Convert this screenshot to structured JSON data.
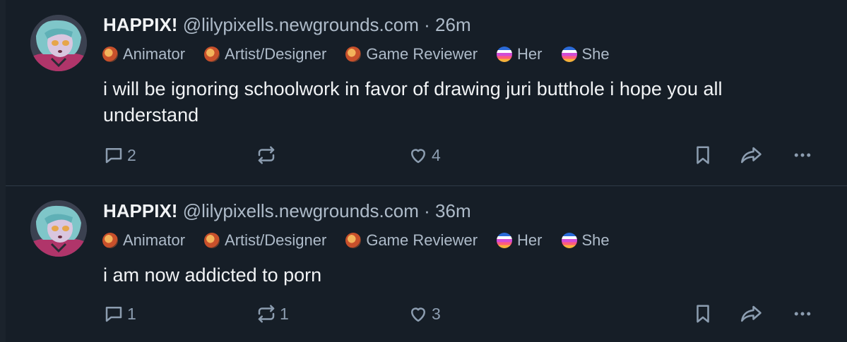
{
  "posts": [
    {
      "display_name": "HAPPIX!",
      "handle": "@lilypixells.newgrounds.com",
      "separator": "·",
      "time": "26m",
      "badges": [
        {
          "label": "Animator",
          "icon": "newgrounds-badge-icon"
        },
        {
          "label": "Artist/Designer",
          "icon": "newgrounds-badge-icon"
        },
        {
          "label": "Game Reviewer",
          "icon": "newgrounds-badge-icon"
        },
        {
          "label": "Her",
          "icon": "pride-flag-badge-icon"
        },
        {
          "label": "She",
          "icon": "pride-flag-badge-icon"
        }
      ],
      "text": "i will be ignoring schoolwork in favor of drawing juri butthole i hope you all understand",
      "reply_count": "2",
      "repost_count": "",
      "like_count": "4"
    },
    {
      "display_name": "HAPPIX!",
      "handle": "@lilypixells.newgrounds.com",
      "separator": "·",
      "time": "36m",
      "badges": [
        {
          "label": "Animator",
          "icon": "newgrounds-badge-icon"
        },
        {
          "label": "Artist/Designer",
          "icon": "newgrounds-badge-icon"
        },
        {
          "label": "Game Reviewer",
          "icon": "newgrounds-badge-icon"
        },
        {
          "label": "Her",
          "icon": "pride-flag-badge-icon"
        },
        {
          "label": "She",
          "icon": "pride-flag-badge-icon"
        }
      ],
      "text": "i am now addicted to porn",
      "reply_count": "1",
      "repost_count": "1",
      "like_count": "3"
    }
  ],
  "colors": {
    "background": "#161e27",
    "primary_text": "#f1f3f5",
    "secondary_text": "#aebbc9",
    "icon": "#8c9db0",
    "divider": "#2e3a47"
  }
}
